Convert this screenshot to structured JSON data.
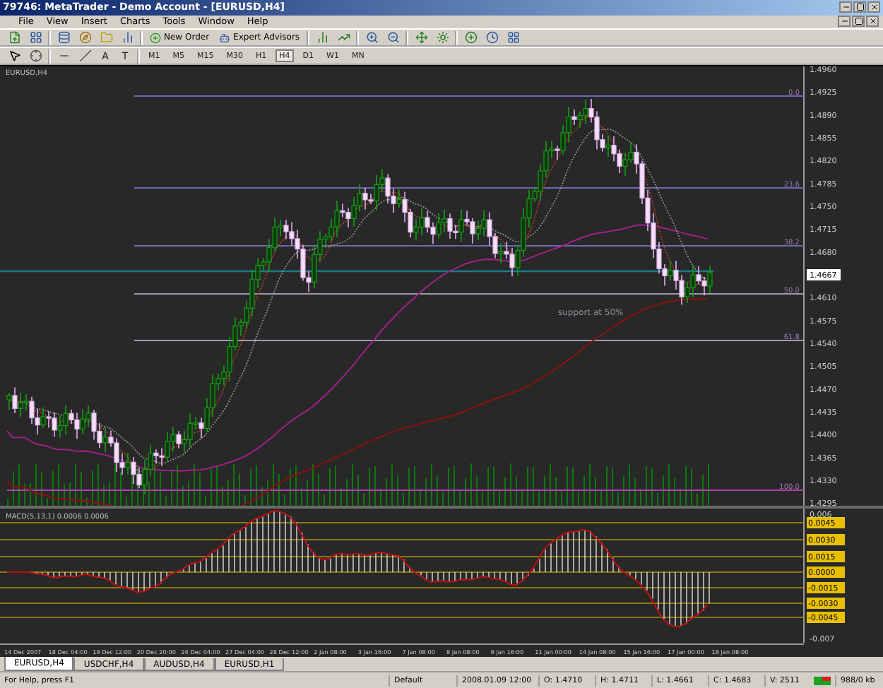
{
  "window": {
    "title": "79746: MetaTrader - Demo Account - [EURUSD,H4]"
  },
  "menu": [
    {
      "label": "File"
    },
    {
      "label": "View"
    },
    {
      "label": "Insert"
    },
    {
      "label": "Charts"
    },
    {
      "label": "Tools"
    },
    {
      "label": "Window"
    },
    {
      "label": "Help"
    }
  ],
  "toolbar": {
    "buttons": [
      {
        "label": "New Order"
      },
      {
        "label": "Expert Advisors"
      }
    ]
  },
  "text_tools": [
    {
      "label": "A"
    },
    {
      "label": "T"
    }
  ],
  "timeframes": [
    {
      "label": "M1",
      "selected": false
    },
    {
      "label": "M5",
      "selected": false
    },
    {
      "label": "M15",
      "selected": false
    },
    {
      "label": "M30",
      "selected": false
    },
    {
      "label": "H1",
      "selected": false
    },
    {
      "label": "H4",
      "selected": true
    },
    {
      "label": "D1",
      "selected": false
    },
    {
      "label": "W1",
      "selected": false
    },
    {
      "label": "MN",
      "selected": false
    }
  ],
  "chart": {
    "header": "EURUSD,H4",
    "annotation": "support at 50%",
    "fib_levels": [
      {
        "label": "0.0"
      },
      {
        "label": "23.6"
      },
      {
        "label": "38.2"
      },
      {
        "label": "50.0"
      },
      {
        "label": "61.8"
      },
      {
        "label": "100.0"
      }
    ],
    "price_axis": [
      {
        "label": "1.4960",
        "kind": "tick"
      },
      {
        "label": "1.4925",
        "kind": "tick"
      },
      {
        "label": "1.4890",
        "kind": "tick"
      },
      {
        "label": "1.4855",
        "kind": "tick"
      },
      {
        "label": "1.4820",
        "kind": "tick"
      },
      {
        "label": "1.4785",
        "kind": "tick"
      },
      {
        "label": "1.4750",
        "kind": "tick"
      },
      {
        "label": "1.4715",
        "kind": "tick"
      },
      {
        "label": "1.4680",
        "kind": "tick"
      },
      {
        "label": "1.4667",
        "kind": "current"
      },
      {
        "label": "1.4610",
        "kind": "tick"
      },
      {
        "label": "1.4575",
        "kind": "tick"
      },
      {
        "label": "1.4540",
        "kind": "tick"
      },
      {
        "label": "1.4505",
        "kind": "tick"
      },
      {
        "label": "1.4470",
        "kind": "tick"
      },
      {
        "label": "1.4435",
        "kind": "tick"
      },
      {
        "label": "1.4400",
        "kind": "tick"
      },
      {
        "label": "1.4365",
        "kind": "tick"
      },
      {
        "label": "1.4330",
        "kind": "tick"
      },
      {
        "label": "1.4295",
        "kind": "tick"
      }
    ]
  },
  "indicator": {
    "title": "MACD(5,13,1) 0.0006 0.0006",
    "axis": [
      {
        "label": "0.006",
        "kind": "tick"
      },
      {
        "label": "0.0045",
        "kind": "level"
      },
      {
        "label": "0.0030",
        "kind": "level"
      },
      {
        "label": "0.0015",
        "kind": "level"
      },
      {
        "label": "0.0000",
        "kind": "level"
      },
      {
        "label": "-0.0015",
        "kind": "level"
      },
      {
        "label": "-0.0030",
        "kind": "level"
      },
      {
        "label": "-0.0045",
        "kind": "level"
      },
      {
        "label": "-0.007",
        "kind": "tick"
      }
    ]
  },
  "time_axis": [
    "14 Dec 2007",
    "18 Dec 04:00",
    "19 Dec 12:00",
    "20 Dec 20:00",
    "24 Dec 04:00",
    "27 Dec 04:00",
    "28 Dec 12:00",
    "2 Jan 08:00",
    "3 Jan 16:00",
    "7 Jan 08:00",
    "8 Jan 08:00",
    "9 Jan 16:00",
    "11 Jan 00:00",
    "14 Jan 08:00",
    "15 Jan 16:00",
    "17 Jan 00:00",
    "18 Jan 08:00"
  ],
  "tabs": [
    {
      "label": "EURUSD,H4",
      "selected": true
    },
    {
      "label": "USDCHF,H4",
      "selected": false
    },
    {
      "label": "AUDUSD,H4",
      "selected": false
    },
    {
      "label": "EURUSD,H1",
      "selected": false
    }
  ],
  "status_bar": {
    "help": "For Help, press F1",
    "profile": "Default",
    "time": "2008.01.09 12:00",
    "open": "O: 1.4710",
    "high": "H: 1.4711",
    "low": "L: 1.4661",
    "close": "C: 1.4683",
    "volume": "V: 2511",
    "traffic": "988/0 kb"
  }
}
